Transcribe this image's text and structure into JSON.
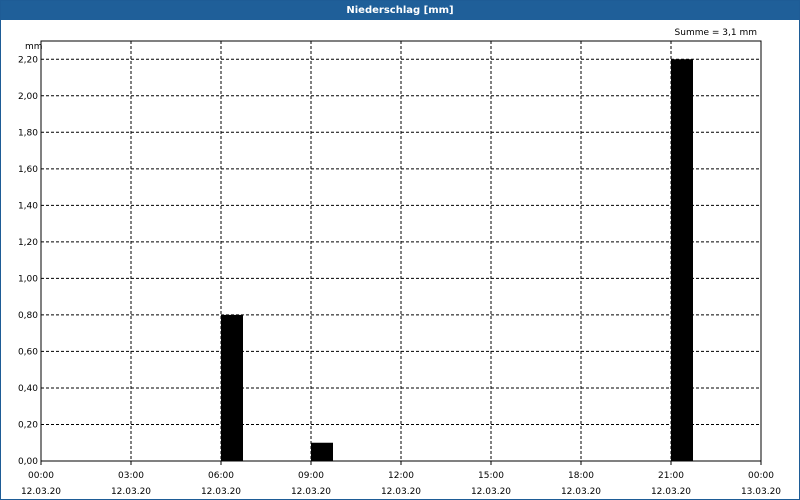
{
  "window": {
    "title": "Niederschlag [mm]"
  },
  "chart_data": {
    "type": "bar",
    "unit_label": "mm",
    "sum_label": "Summe = 3,1 mm",
    "x_ticks": [
      {
        "time": "00:00",
        "date": "12.03.20"
      },
      {
        "time": "03:00",
        "date": "12.03.20"
      },
      {
        "time": "06:00",
        "date": "12.03.20"
      },
      {
        "time": "09:00",
        "date": "12.03.20"
      },
      {
        "time": "12:00",
        "date": "12.03.20"
      },
      {
        "time": "15:00",
        "date": "12.03.20"
      },
      {
        "time": "18:00",
        "date": "12.03.20"
      },
      {
        "time": "21:00",
        "date": "12.03.20"
      },
      {
        "time": "00:00",
        "date": "13.03.20"
      }
    ],
    "y_ticks": [
      "0,00",
      "0,20",
      "0,40",
      "0,60",
      "0,80",
      "1,00",
      "1,20",
      "1,40",
      "1,60",
      "1,80",
      "2,00",
      "2,20"
    ],
    "xlim": [
      "12.03.20 00:00",
      "13.03.20 00:00"
    ],
    "ylim": [
      0,
      2.3
    ],
    "grid": true,
    "bar_color": "#000000",
    "points": [
      {
        "time": "12.03.20 06:00",
        "value": 0.8
      },
      {
        "time": "12.03.20 09:00",
        "value": 0.1
      },
      {
        "time": "12.03.20 21:00",
        "value": 2.2
      }
    ]
  }
}
